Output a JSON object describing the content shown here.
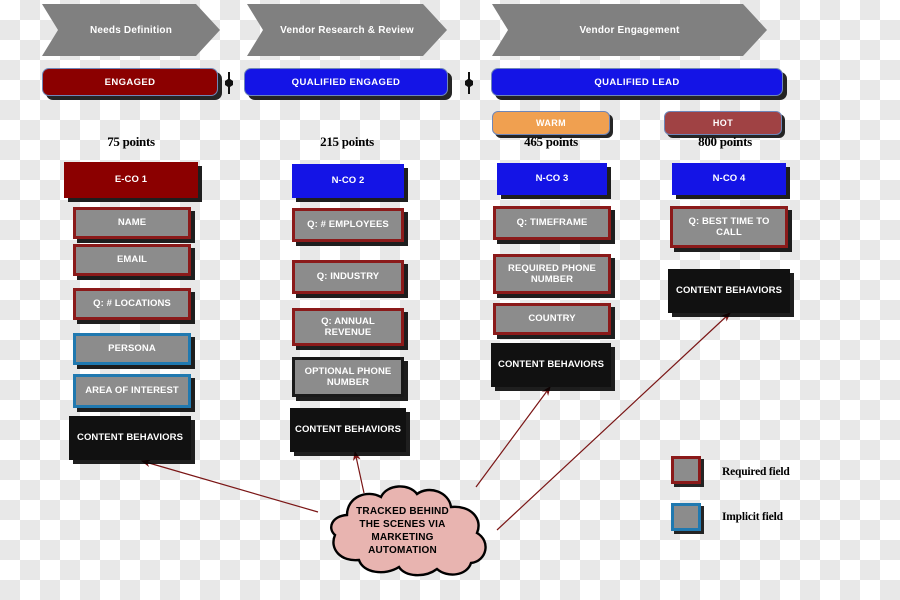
{
  "stages": [
    {
      "label": "Needs Definition"
    },
    {
      "label": "Vendor Research & Review"
    },
    {
      "label": "Vendor Engagement"
    }
  ],
  "banners": [
    {
      "label": "ENGAGED",
      "color": "#8b0000"
    },
    {
      "label": "QUALIFIED ENGAGED",
      "color": "#1414e6"
    },
    {
      "label": "QUALIFIED LEAD",
      "color": "#1414e6"
    }
  ],
  "temperature_badges": [
    {
      "label": "WARM",
      "color": "#f0a050"
    },
    {
      "label": "HOT",
      "color": "#a04244"
    }
  ],
  "columns": [
    {
      "points": "75 points",
      "header": {
        "label": "E-CO 1",
        "kind": "head-red"
      },
      "fields": [
        {
          "label": "NAME",
          "kind": "required"
        },
        {
          "label": "EMAIL",
          "kind": "required"
        },
        {
          "label": "Q: # LOCATIONS",
          "kind": "required"
        },
        {
          "label": "PERSONA",
          "kind": "implicit"
        },
        {
          "label": "AREA OF INTEREST",
          "kind": "implicit"
        },
        {
          "label": "CONTENT BEHAVIORS",
          "kind": "content"
        }
      ]
    },
    {
      "points": "215 points",
      "header": {
        "label": "N-CO 2",
        "kind": "head-blue"
      },
      "fields": [
        {
          "label": "Q: # EMPLOYEES",
          "kind": "required"
        },
        {
          "label": "Q: INDUSTRY",
          "kind": "required"
        },
        {
          "label": "Q: ANNUAL REVENUE",
          "kind": "required"
        },
        {
          "label": "OPTIONAL PHONE NUMBER",
          "kind": "optional"
        },
        {
          "label": "CONTENT BEHAVIORS",
          "kind": "content"
        }
      ]
    },
    {
      "points": "465 points",
      "header": {
        "label": "N-CO 3",
        "kind": "head-blue"
      },
      "fields": [
        {
          "label": "Q: TIMEFRAME",
          "kind": "required"
        },
        {
          "label": "REQUIRED PHONE NUMBER",
          "kind": "required"
        },
        {
          "label": "COUNTRY",
          "kind": "required"
        },
        {
          "label": "CONTENT BEHAVIORS",
          "kind": "content"
        }
      ]
    },
    {
      "points": "800 points",
      "header": {
        "label": "N-CO 4",
        "kind": "head-blue"
      },
      "fields": [
        {
          "label": "Q: BEST TIME TO CALL",
          "kind": "required"
        },
        {
          "label": "CONTENT BEHAVIORS",
          "kind": "content"
        }
      ]
    }
  ],
  "cloud": {
    "lines": [
      "TRACKED BEHIND",
      "THE SCENES VIA",
      "MARKETING",
      "AUTOMATION"
    ],
    "fill": "#e8b4b0"
  },
  "legend": [
    {
      "label": "Required field",
      "border": "#8b1a1a"
    },
    {
      "label": "Implicit field",
      "border": "#2079b0"
    }
  ],
  "colors": {
    "stage_grey": "#808080",
    "field_grey": "#8c8c8c",
    "dark_red": "#8b0000",
    "blue": "#1414e6",
    "arrow": "#7a1515",
    "content_black": "#111111"
  }
}
